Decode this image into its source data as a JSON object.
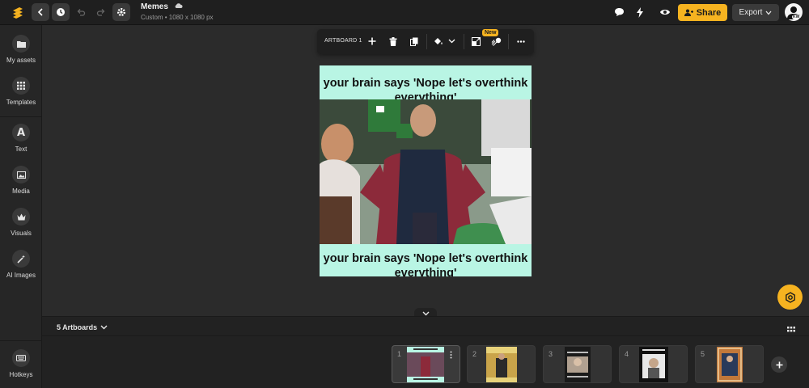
{
  "header": {
    "document_title": "Memes",
    "document_subtitle": "Custom • 1080 x 1080 px",
    "share_label": "Share",
    "export_label": "Export",
    "avatar_initials": "KW"
  },
  "sidebar": {
    "items": [
      {
        "label": "My assets",
        "icon": "folder-icon"
      },
      {
        "label": "Templates",
        "icon": "grid-icon"
      },
      {
        "label": "Text",
        "icon": "text-icon"
      },
      {
        "label": "Media",
        "icon": "image-icon"
      },
      {
        "label": "Visuals",
        "icon": "crown-icon"
      },
      {
        "label": "AI Images",
        "icon": "magic-wand-icon"
      }
    ],
    "hotkeys_label": "Hotkeys"
  },
  "toolbar": {
    "artboard_label": "ARTBOARD 1",
    "new_badge": "New"
  },
  "artboard": {
    "caption_top": "your brain says 'Nope let's overthink everything'",
    "caption_bottom": "your brain says 'Nope let's overthink everything'",
    "background_color": "#b9f5e4"
  },
  "bottom_panel": {
    "artboards_count_label": "5 Artboards",
    "thumbnails": [
      {
        "number": "1",
        "active": true
      },
      {
        "number": "2",
        "active": false
      },
      {
        "number": "3",
        "active": false
      },
      {
        "number": "4",
        "active": false
      },
      {
        "number": "5",
        "active": false
      }
    ]
  },
  "colors": {
    "accent": "#f6b320",
    "background": "#2b2b2b",
    "panel": "#1f1f1f"
  }
}
